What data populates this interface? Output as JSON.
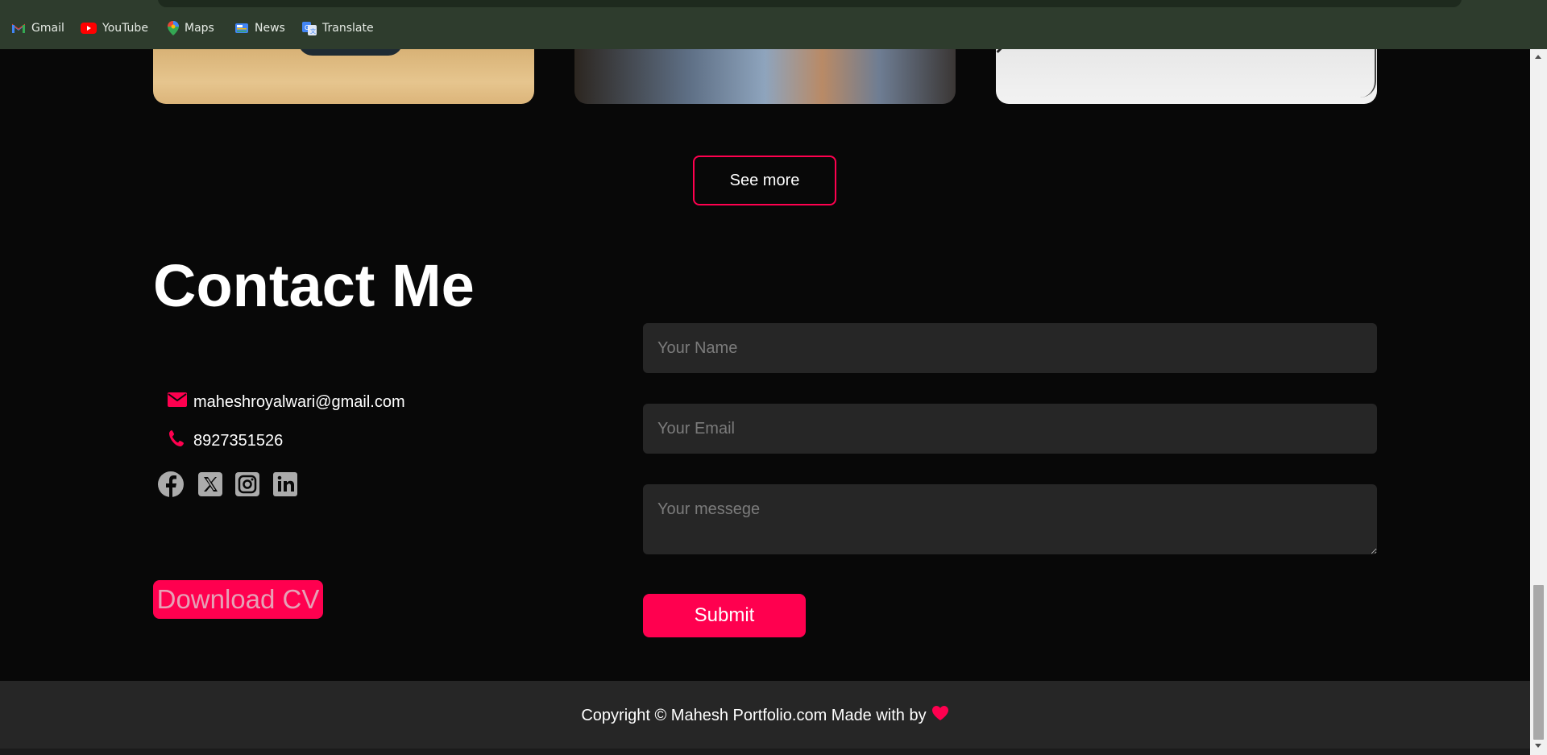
{
  "bookmarks": [
    {
      "label": "Gmail",
      "icon": "gmail-icon"
    },
    {
      "label": "YouTube",
      "icon": "youtube-icon"
    },
    {
      "label": "Maps",
      "icon": "maps-icon"
    },
    {
      "label": "News",
      "icon": "news-icon"
    },
    {
      "label": "Translate",
      "icon": "translate-icon"
    }
  ],
  "portfolio": {
    "see_more_label": "See more"
  },
  "contact": {
    "title": "Contact Me",
    "email": "maheshroyalwari@gmail.com",
    "phone": "8927351526",
    "socials": [
      "facebook-icon",
      "x-icon",
      "instagram-icon",
      "linkedin-icon"
    ],
    "download_cv_label": "Download CV"
  },
  "form": {
    "name_placeholder": "Your Name",
    "email_placeholder": "Your Email",
    "message_placeholder": "Your messege",
    "submit_label": "Submit"
  },
  "footer": {
    "text": "Copyright © Mahesh Portfolio.com Made with by"
  },
  "colors": {
    "accent": "#ff004f",
    "background": "#080808",
    "field_bg": "#262626",
    "bookmarks_bar": "#2e3c2d"
  }
}
